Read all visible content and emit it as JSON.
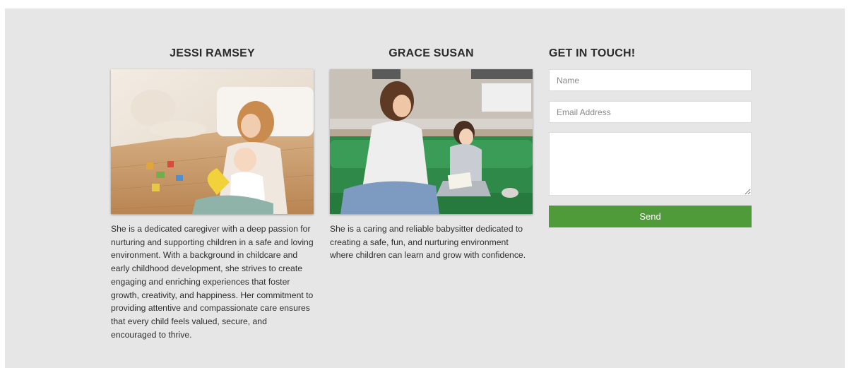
{
  "profiles": [
    {
      "name": "JESSI RAMSEY",
      "bio": "She is a dedicated caregiver with a deep passion for nurturing and supporting children in a safe and loving environment. With a background in childcare and early childhood development, she strives to create engaging and enriching experiences that foster growth, creativity, and happiness. Her commitment to providing attentive and compassionate care ensures that every child feels valued, secure, and encouraged to thrive."
    },
    {
      "name": "GRACE SUSAN",
      "bio": "She is a caring and reliable babysitter dedicated to creating a safe, fun, and nurturing environment where children can learn and grow with confidence."
    }
  ],
  "contact": {
    "title": "GET IN TOUCH!",
    "name_placeholder": "Name",
    "email_placeholder": "Email Address",
    "message_placeholder": "",
    "send_label": "Send"
  },
  "colors": {
    "panel_bg": "#e6e6e6",
    "accent_green": "#4f9a39"
  }
}
